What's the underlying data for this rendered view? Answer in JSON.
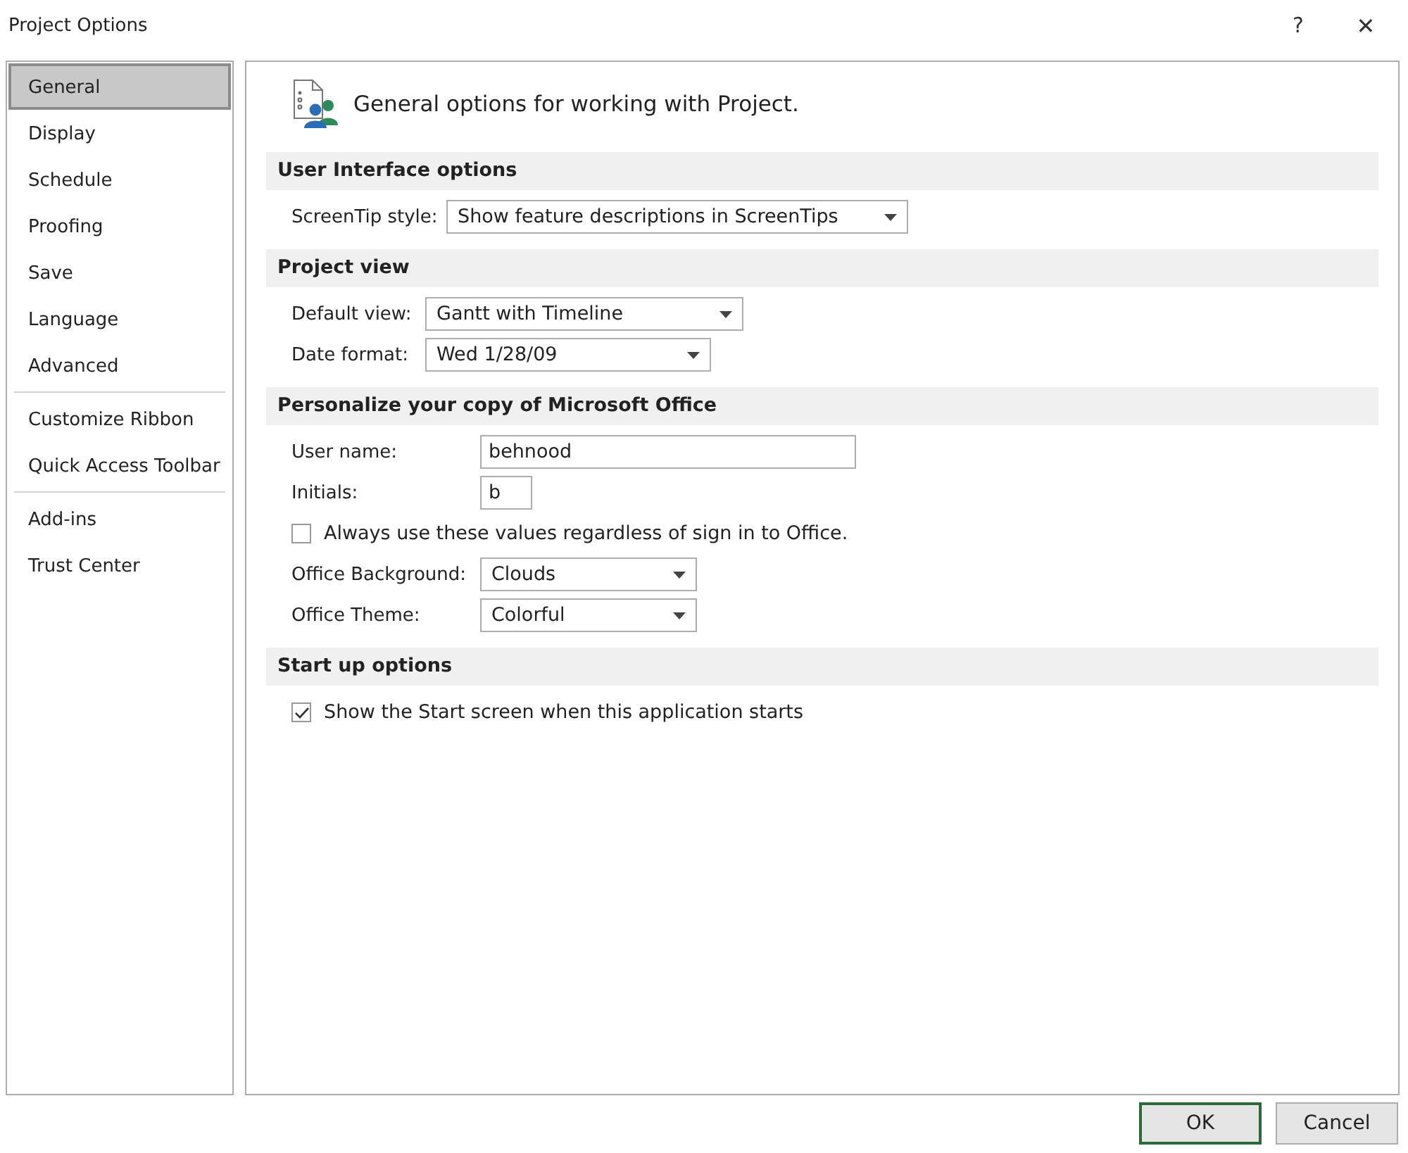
{
  "window": {
    "title": "Project Options",
    "help": "?",
    "close": "✕"
  },
  "sidebar": {
    "groups": [
      [
        {
          "label": "General",
          "selected": true
        },
        {
          "label": "Display",
          "selected": false
        },
        {
          "label": "Schedule",
          "selected": false
        },
        {
          "label": "Proofing",
          "selected": false
        },
        {
          "label": "Save",
          "selected": false
        },
        {
          "label": "Language",
          "selected": false
        },
        {
          "label": "Advanced",
          "selected": false
        }
      ],
      [
        {
          "label": "Customize Ribbon",
          "selected": false
        },
        {
          "label": "Quick Access Toolbar",
          "selected": false
        }
      ],
      [
        {
          "label": "Add-ins",
          "selected": false
        },
        {
          "label": "Trust Center",
          "selected": false
        }
      ]
    ]
  },
  "main": {
    "heading": "General options for working with Project.",
    "sections": [
      {
        "title": "User Interface options",
        "rows": [
          {
            "kind": "dropdown",
            "label": "ScreenTip style:",
            "value": "Show feature descriptions in ScreenTips"
          }
        ]
      },
      {
        "title": "Project view",
        "rows": [
          {
            "kind": "dropdown",
            "label": "Default view:",
            "value": "Gantt with Timeline"
          },
          {
            "kind": "dropdown",
            "label": "Date format:",
            "value": "Wed 1/28/09"
          }
        ]
      },
      {
        "title": "Personalize your copy of Microsoft Office",
        "rows": [
          {
            "kind": "text",
            "label": "User name:",
            "value": "behnood"
          },
          {
            "kind": "text",
            "label": "Initials:",
            "value": "b"
          },
          {
            "kind": "checkbox",
            "label": "Always use these values regardless of sign in to Office.",
            "checked": false
          },
          {
            "kind": "dropdown",
            "label": "Office Background:",
            "value": "Clouds"
          },
          {
            "kind": "dropdown",
            "label": "Office Theme:",
            "value": "Colorful"
          }
        ]
      },
      {
        "title": "Start up options",
        "rows": [
          {
            "kind": "checkbox",
            "label": "Show the Start screen when this application starts",
            "checked": true
          }
        ]
      }
    ]
  },
  "buttons": [
    {
      "label": "OK",
      "default": true
    },
    {
      "label": "Cancel",
      "default": false
    }
  ]
}
